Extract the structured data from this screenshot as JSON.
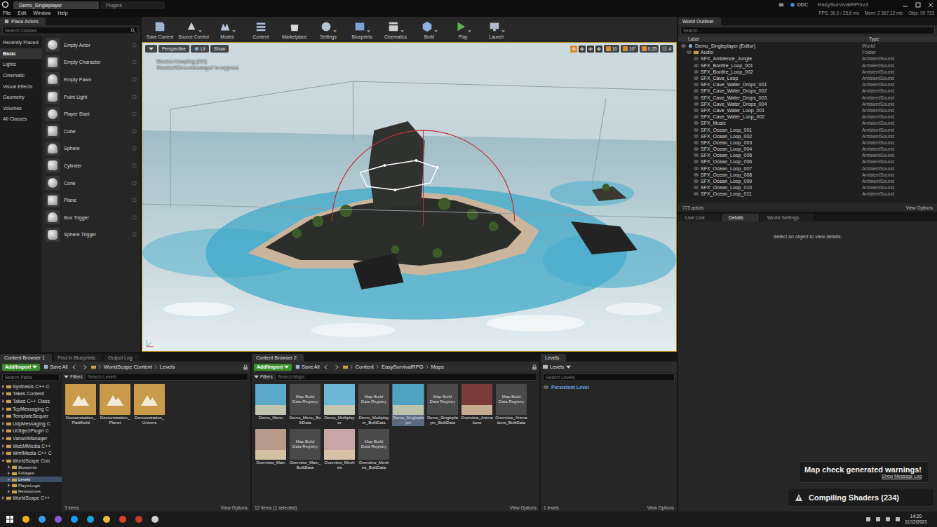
{
  "title_bar": {
    "tabs": [
      {
        "label": "Demo_Singleplayer",
        "selected": true
      },
      {
        "label": "Plugins",
        "selected": false
      }
    ],
    "source_control": "DDC",
    "project": "EasySurvivalRPGv3"
  },
  "menu": [
    "File",
    "Edit",
    "Window",
    "Help"
  ],
  "stats": [
    "FPS: 39,0 / 25,6 ms",
    "Mem: 2 367,12 mb",
    "Objs: 99 733"
  ],
  "place_actors": {
    "title": "Place Actors",
    "search": "Search Classes",
    "categories": [
      {
        "label": "Recently Placed",
        "selected": false
      },
      {
        "label": "Basic",
        "selected": true
      },
      {
        "label": "Lights",
        "selected": false
      },
      {
        "label": "Cinematic",
        "selected": false
      },
      {
        "label": "Visual Effects",
        "selected": false
      },
      {
        "label": "Geometry",
        "selected": false
      },
      {
        "label": "Volumes",
        "selected": false
      },
      {
        "label": "All Classes",
        "selected": false
      }
    ],
    "items": [
      "Empty Actor",
      "Empty Character",
      "Empty Pawn",
      "Point Light",
      "Player Start",
      "Cube",
      "Sphere",
      "Cylinder",
      "Cone",
      "Plane",
      "Box Trigger",
      "Sphere Trigger"
    ]
  },
  "toolbar": [
    {
      "label": "Save Current",
      "dropdown": false
    },
    {
      "label": "Source Control",
      "dropdown": true
    },
    {
      "label": "Modes",
      "dropdown": true
    },
    {
      "label": "Content",
      "dropdown": false
    },
    {
      "label": "Marketplace",
      "dropdown": false
    },
    {
      "label": "Settings",
      "dropdown": true
    },
    {
      "label": "Blueprints",
      "dropdown": true
    },
    {
      "label": "Cinematics",
      "dropdown": true
    },
    {
      "label": "Build",
      "dropdown": true
    },
    {
      "label": "Play",
      "dropdown": true
    },
    {
      "label": "Launch",
      "dropdown": true
    }
  ],
  "viewport": {
    "view": "Perspective",
    "lighting": "Lit",
    "show": "Show",
    "messages": [
      "Shaders Compiling (234)",
      "'DisableAllScreenMessages' to suppress"
    ],
    "snaps": [
      {
        "value": "10",
        "on": true
      },
      {
        "value": "10°",
        "on": true
      },
      {
        "value": "0,25",
        "on": true
      },
      {
        "value": "4",
        "on": false
      }
    ]
  },
  "outliner": {
    "title": "World Outliner",
    "search": "Search...",
    "columns": [
      "Label",
      "Type"
    ],
    "rows": [
      {
        "label": "Demo_Singleplayer (Editor)",
        "type": "World",
        "kind": "world"
      },
      {
        "label": "Audio",
        "type": "Folder",
        "kind": "folder"
      },
      {
        "label": "SFX_Ambience_Jungle",
        "type": "AmbientSound",
        "kind": "actor"
      },
      {
        "label": "SFX_Bonfire_Loop_001",
        "type": "AmbientSound",
        "kind": "actor"
      },
      {
        "label": "SFX_Bonfire_Loop_002",
        "type": "AmbientSound",
        "kind": "actor"
      },
      {
        "label": "SFX_Cave_Loop",
        "type": "AmbientSound",
        "kind": "actor"
      },
      {
        "label": "SFX_Cave_Water_Drops_001",
        "type": "AmbientSound",
        "kind": "actor"
      },
      {
        "label": "SFX_Cave_Water_Drops_002",
        "type": "AmbientSound",
        "kind": "actor"
      },
      {
        "label": "SFX_Cave_Water_Drops_003",
        "type": "AmbientSound",
        "kind": "actor"
      },
      {
        "label": "SFX_Cave_Water_Drops_004",
        "type": "AmbientSound",
        "kind": "actor"
      },
      {
        "label": "SFX_Cave_Water_Loop_001",
        "type": "AmbientSound",
        "kind": "actor"
      },
      {
        "label": "SFX_Cave_Water_Loop_002",
        "type": "AmbientSound",
        "kind": "actor"
      },
      {
        "label": "SFX_Music",
        "type": "AmbientSound",
        "kind": "actor"
      },
      {
        "label": "SFX_Ocean_Loop_001",
        "type": "AmbientSound",
        "kind": "actor"
      },
      {
        "label": "SFX_Ocean_Loop_002",
        "type": "AmbientSound",
        "kind": "actor"
      },
      {
        "label": "SFX_Ocean_Loop_003",
        "type": "AmbientSound",
        "kind": "actor"
      },
      {
        "label": "SFX_Ocean_Loop_004",
        "type": "AmbientSound",
        "kind": "actor"
      },
      {
        "label": "SFX_Ocean_Loop_005",
        "type": "AmbientSound",
        "kind": "actor"
      },
      {
        "label": "SFX_Ocean_Loop_006",
        "type": "AmbientSound",
        "kind": "actor"
      },
      {
        "label": "SFX_Ocean_Loop_007",
        "type": "AmbientSound",
        "kind": "actor"
      },
      {
        "label": "SFX_Ocean_Loop_008",
        "type": "AmbientSound",
        "kind": "actor"
      },
      {
        "label": "SFX_Ocean_Loop_009",
        "type": "AmbientSound",
        "kind": "actor"
      },
      {
        "label": "SFX_Ocean_Loop_010",
        "type": "AmbientSound",
        "kind": "actor"
      },
      {
        "label": "SFX_Ocean_Loop_011",
        "type": "AmbientSound",
        "kind": "actor"
      }
    ],
    "count": "773 actors",
    "view_options": "View Options"
  },
  "details": {
    "tabs": [
      {
        "label": "Live Link",
        "selected": false
      },
      {
        "label": "Details",
        "selected": true
      },
      {
        "label": "World Settings",
        "selected": false
      }
    ],
    "empty": "Select an object to view details."
  },
  "content_browser_1": {
    "tabs": [
      {
        "label": "Content Browser 1",
        "selected": true
      },
      {
        "label": "Find in Blueprints",
        "selected": false
      },
      {
        "label": "Output Log",
        "selected": false
      }
    ],
    "add": "Add/Import",
    "save": "Save All",
    "path": [
      "WorldScape Content",
      "Levels"
    ],
    "search_paths": "Search Paths",
    "filters": "Filters",
    "search": "Search Levels",
    "tree": [
      {
        "label": "Synthesis C++ C",
        "kind": "folder",
        "expanded": false,
        "selected": false
      },
      {
        "label": "Takes Content",
        "kind": "folder",
        "expanded": false,
        "selected": false
      },
      {
        "label": "Takes C++ Class",
        "kind": "folder",
        "expanded": false,
        "selected": false
      },
      {
        "label": "TcpMessaging C",
        "kind": "folder",
        "expanded": false,
        "selected": false
      },
      {
        "label": "TemplateSequer",
        "kind": "folder",
        "expanded": false,
        "selected": false
      },
      {
        "label": "UdpMessaging C",
        "kind": "folder",
        "expanded": false,
        "selected": false
      },
      {
        "label": "UObjectPlugin C",
        "kind": "folder",
        "expanded": false,
        "selected": false
      },
      {
        "label": "VariantManager",
        "kind": "folder",
        "expanded": false,
        "selected": false
      },
      {
        "label": "WebMMedia C++",
        "kind": "folder",
        "expanded": false,
        "selected": false
      },
      {
        "label": "WmfMedia C++ C",
        "kind": "folder",
        "expanded": false,
        "selected": false
      },
      {
        "label": "WorldScape Con",
        "kind": "folder",
        "expanded": true,
        "selected": false
      },
      {
        "label": "Blueprints",
        "kind": "subfolder",
        "expanded": false,
        "selected": false
      },
      {
        "label": "Foliages",
        "kind": "subfolder",
        "expanded": false,
        "selected": false
      },
      {
        "label": "Levels",
        "kind": "subfolder",
        "expanded": false,
        "selected": true
      },
      {
        "label": "PlayerLogic",
        "kind": "subfolder",
        "expanded": false,
        "selected": false
      },
      {
        "label": "Ressources",
        "kind": "subfolder",
        "expanded": false,
        "selected": false
      },
      {
        "label": "WorldScape C++",
        "kind": "folder",
        "expanded": false,
        "selected": false
      }
    ],
    "assets": [
      "Demonstration_FlatWorld",
      "Demonstration_Planet",
      "Demonstration_Univers"
    ],
    "count": "3 items",
    "view_options": "View Options"
  },
  "content_browser_2": {
    "tab": "Content Browser 2",
    "add": "Add/Import",
    "save": "Save All",
    "path": [
      "Content",
      "EasySurvivalRPG",
      "Maps"
    ],
    "filters": "Filters",
    "search": "Search Maps",
    "assets": [
      {
        "label": "Demo_Menu",
        "kind": "image",
        "thumb": "",
        "selected": false,
        "color": "#5aa9c9"
      },
      {
        "label": "Demo_Menu_BuiltData",
        "kind": "registry",
        "thumb": "Map Build Data Registry",
        "selected": false,
        "color": "#4a4a4a"
      },
      {
        "label": "Demo_Multiplayer",
        "kind": "image",
        "thumb": "",
        "selected": false,
        "color": "#6cb7d6"
      },
      {
        "label": "Demo_Multiplayer_BuiltData",
        "kind": "registry",
        "thumb": "Map Build Data Registry",
        "selected": false,
        "color": "#4a4a4a"
      },
      {
        "label": "Demo_Singleplayer",
        "kind": "image",
        "thumb": "",
        "selected": true,
        "color": "#4fa3c2"
      },
      {
        "label": "Demo_Singleplayer_BuiltData",
        "kind": "registry",
        "thumb": "Map Build Data Registry",
        "selected": false,
        "color": "#4a4a4a"
      },
      {
        "label": "Overview_Animations",
        "kind": "image",
        "thumb": "",
        "selected": false,
        "color": "#7a3b3b"
      },
      {
        "label": "Overview_Animations_BuiltData",
        "kind": "registry",
        "thumb": "Map Build Data Registry",
        "selected": false,
        "color": "#4a4a4a"
      },
      {
        "label": "Overview_Main",
        "kind": "image",
        "thumb": "",
        "selected": false,
        "color": "#b89a8a"
      },
      {
        "label": "Overview_Main_BuiltData",
        "kind": "registry",
        "thumb": "Map Build Data Registry",
        "selected": false,
        "color": "#4a4a4a"
      },
      {
        "label": "Overview_Meshes",
        "kind": "image",
        "thumb": "",
        "selected": false,
        "color": "#c9a6a6"
      },
      {
        "label": "Overview_Meshes_BuiltData",
        "kind": "registry",
        "thumb": "Map Build Data Registry",
        "selected": false,
        "color": "#4a4a4a"
      }
    ],
    "count": "12 items (1 selected)",
    "view_options": "View Options"
  },
  "levels": {
    "tab": "Levels",
    "menu": "Levels",
    "search": "Search Levels",
    "items": [
      {
        "label": "Persistent Level",
        "selected": false
      }
    ],
    "count": "1 levels",
    "view_options": "View Options"
  },
  "toasts": [
    {
      "text": "Map check generated warnings!",
      "link": "Show Message Log",
      "kind": "info"
    },
    {
      "text": "Compiling Shaders (234)",
      "link": "",
      "kind": "progress"
    }
  ],
  "taskbar": {
    "time": "14:20",
    "date": "11/12/2021"
  }
}
